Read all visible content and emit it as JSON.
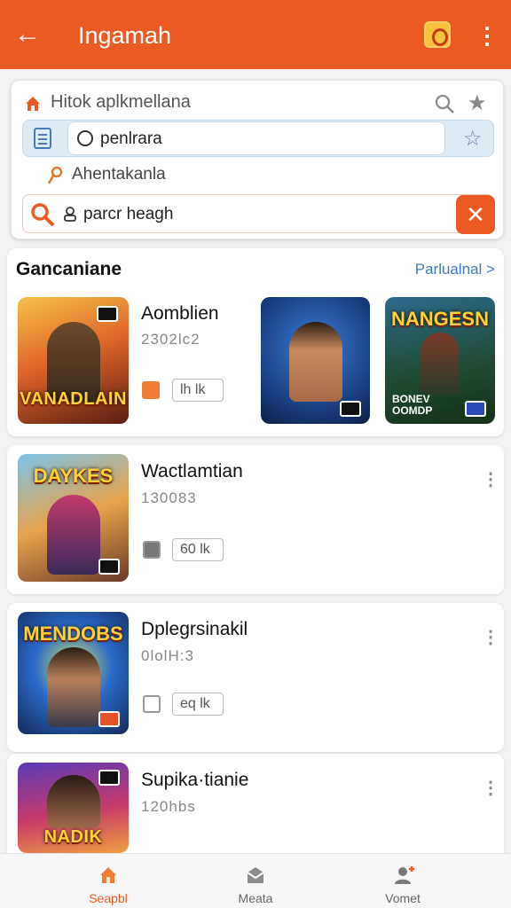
{
  "topbar": {
    "title": "Ingamah"
  },
  "search": {
    "breadcrumb": "Hitok aplkmellana",
    "field_value": "penlrara",
    "location": "Ahentakanla",
    "query": "parcr heagh"
  },
  "section": {
    "heading": "Gancaniane",
    "more_link": "Parlualnal >",
    "featured": {
      "name": "Aomblien",
      "meta": "2302lc2",
      "tag": "lh lk",
      "art1_title": "VANADLAIN",
      "art3_title": "NANGESN",
      "art3_sub": "BONEV OOMDP"
    }
  },
  "apps": [
    {
      "name": "Wactlamtian",
      "meta": "130083",
      "tag": "60 lk",
      "art_title": "DAYKES"
    },
    {
      "name": "Dplegrsinakil",
      "meta": "0lolH:3",
      "tag": "eq lk",
      "art_title": "MENDOBS"
    },
    {
      "name": "Supika·tianie",
      "meta": "120hbs",
      "tag": "",
      "art_title": "NADIK"
    }
  ],
  "bottom_nav": [
    {
      "label": "Seapbl",
      "icon": "home-icon",
      "active": true
    },
    {
      "label": "Meata",
      "icon": "inbox-icon",
      "active": false
    },
    {
      "label": "Vomet",
      "icon": "profile-icon",
      "active": false
    }
  ],
  "colors": {
    "accent": "#ec5a24",
    "link": "#3f7bbf"
  }
}
